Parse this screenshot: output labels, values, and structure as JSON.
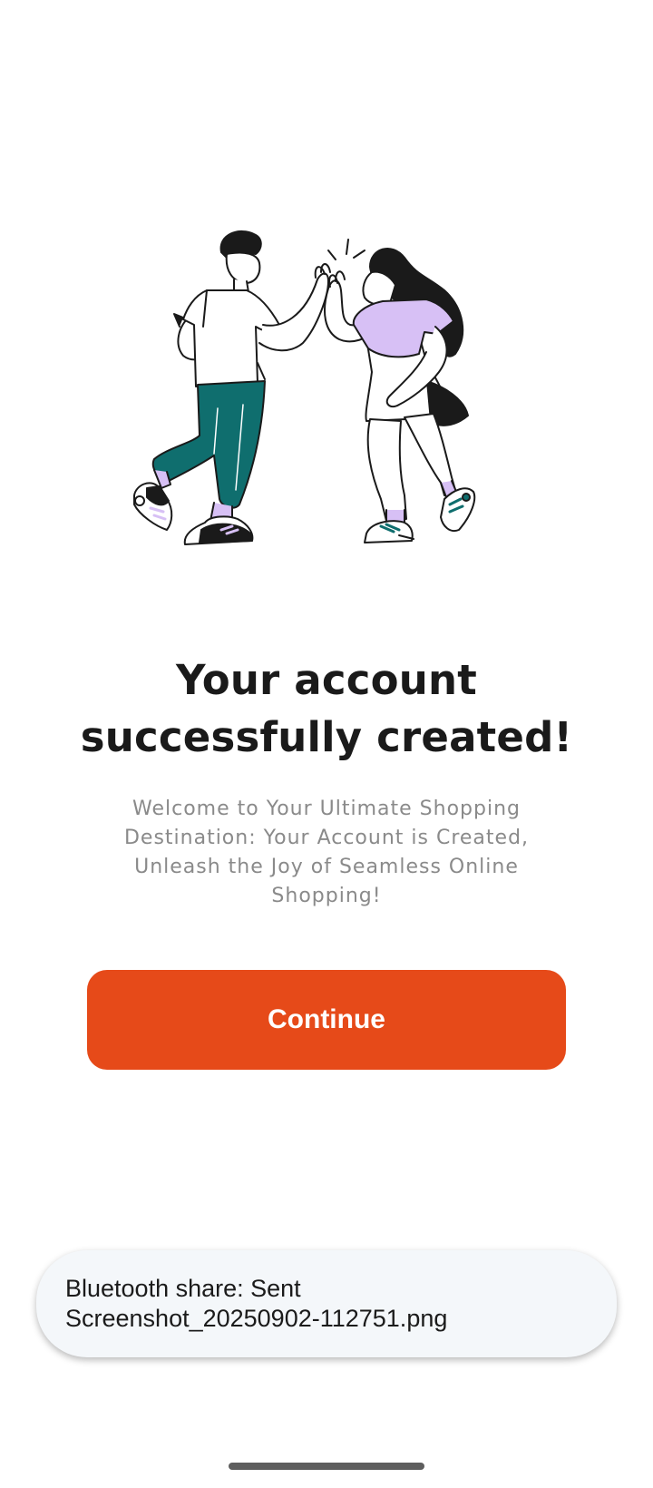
{
  "success": {
    "title": "Your account successfully created!",
    "subtitle": "Welcome to Your Ultimate Shopping Destination: Your Account is Created, Unleash the Joy of Seamless Online Shopping!",
    "continue_label": "Continue"
  },
  "illustration": {
    "icon": "high-five-illustration"
  },
  "toast": {
    "line1": "Bluetooth share: Sent",
    "line2": "Screenshot_20250902-112751.png"
  },
  "colors": {
    "accent": "#e64a19",
    "teal": "#0f6e6e",
    "lavender": "#d7c0f5",
    "text_primary": "#1a1a1a",
    "text_secondary": "#8a8a8a"
  }
}
